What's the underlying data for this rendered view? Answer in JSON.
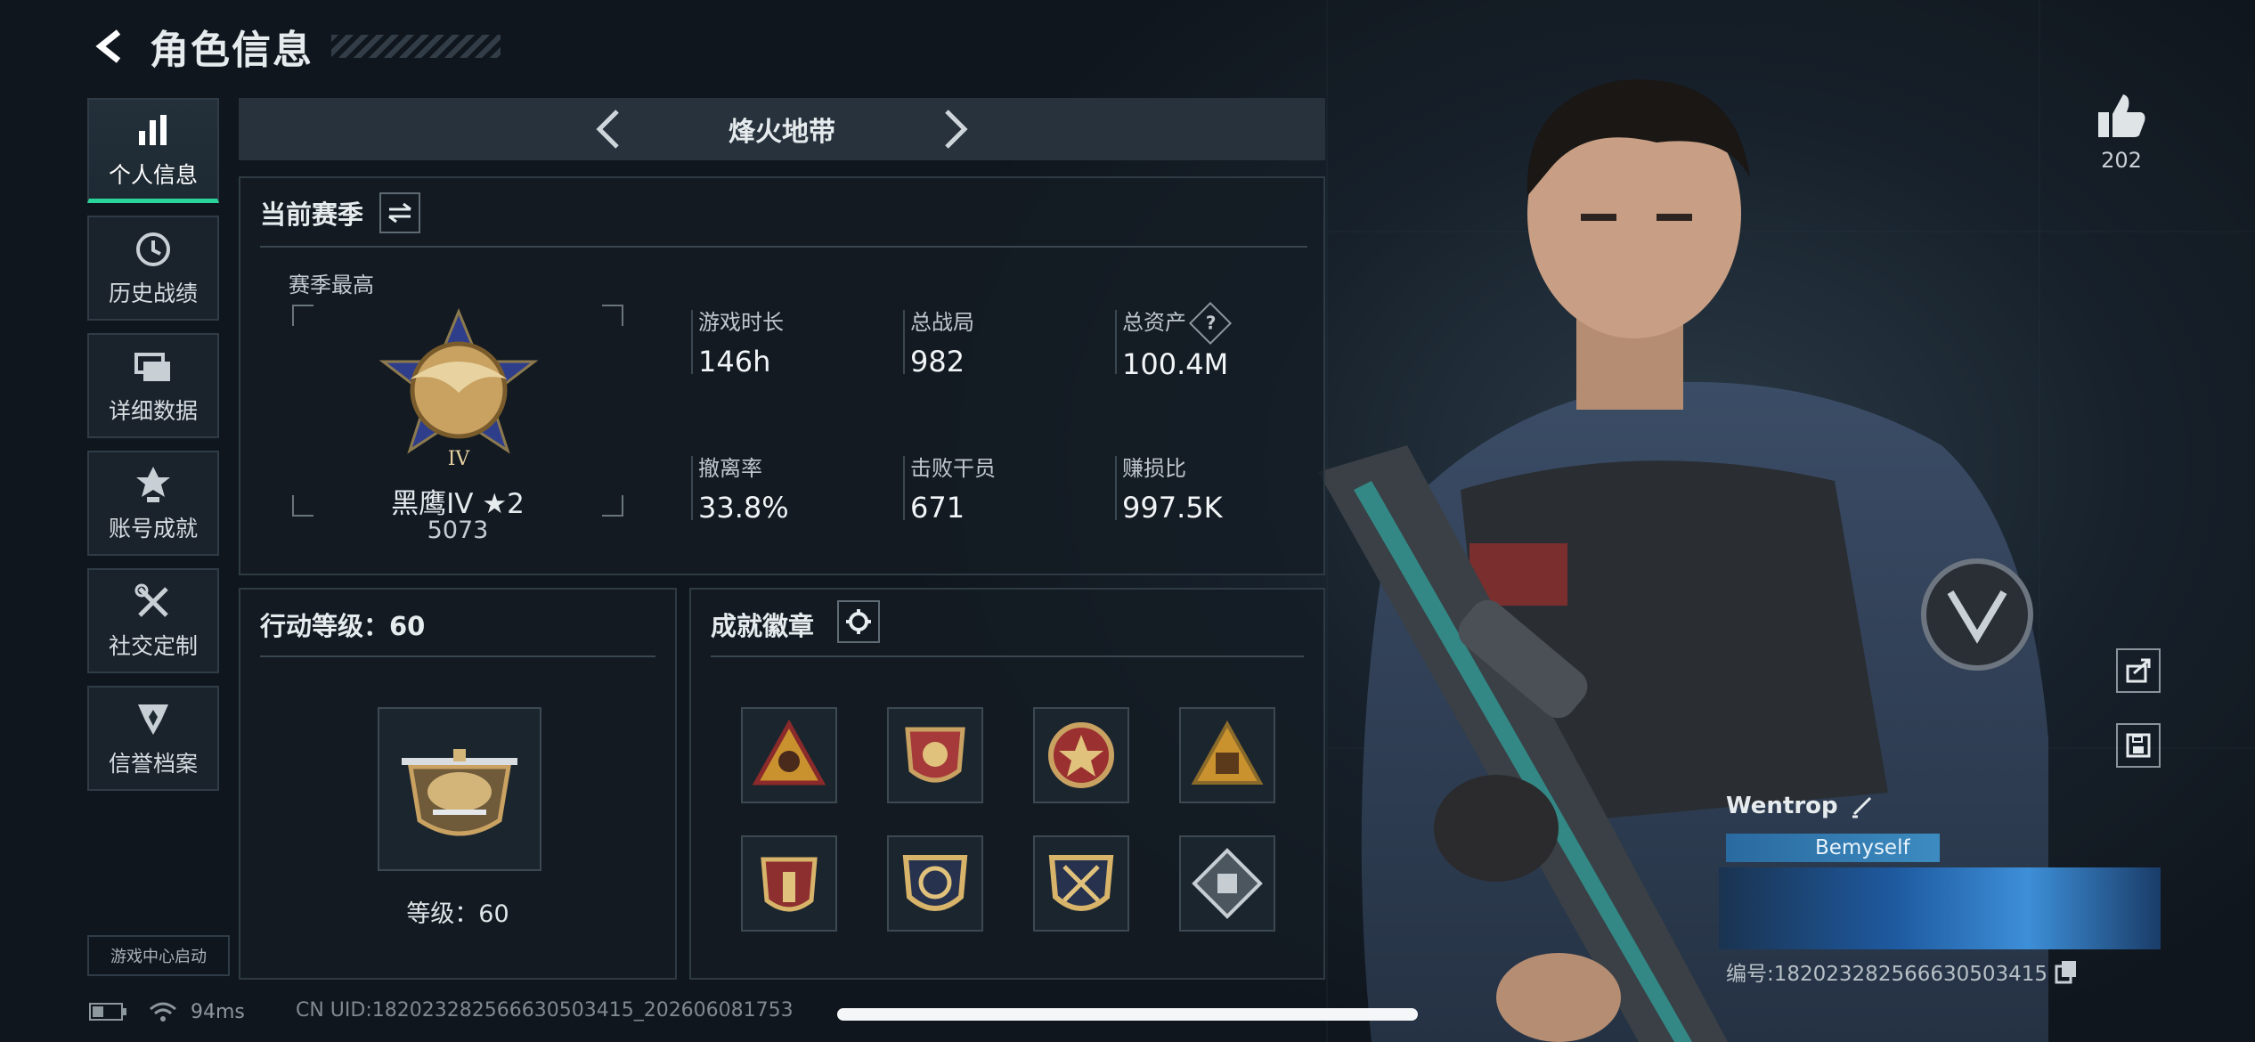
{
  "header": {
    "title": "角色信息"
  },
  "sidebar": {
    "items": [
      {
        "label": "个人信息",
        "icon": "bar-chart-icon",
        "active": true
      },
      {
        "label": "历史战绩",
        "icon": "clock-icon"
      },
      {
        "label": "详细数据",
        "icon": "folder-icon"
      },
      {
        "label": "账号成就",
        "icon": "medal-icon"
      },
      {
        "label": "社交定制",
        "icon": "tools-icon"
      },
      {
        "label": "信誉档案",
        "icon": "shield-icon"
      }
    ],
    "launch_label": "游戏中心启动"
  },
  "mode": {
    "title": "烽火地带"
  },
  "season": {
    "label": "当前赛季",
    "best_label": "赛季最高",
    "rank_name": "黑鹰IV ★2",
    "rank_score": "5073",
    "stats": [
      {
        "key": "游戏时长",
        "value": "146h"
      },
      {
        "key": "总战局",
        "value": "982"
      },
      {
        "key": "总资产",
        "value": "100.4M",
        "help": "?"
      },
      {
        "key": "撤离率",
        "value": "33.8%"
      },
      {
        "key": "击败干员",
        "value": "671"
      },
      {
        "key": "赚损比",
        "value": "997.5K"
      }
    ]
  },
  "level": {
    "title": "行动等级：60",
    "level_text": "等级：60"
  },
  "badges": {
    "title": "成就徽章",
    "items": [
      "badge-1",
      "badge-2",
      "badge-3",
      "badge-4",
      "badge-5",
      "badge-6",
      "badge-7",
      "badge-8"
    ]
  },
  "status": {
    "ping": "94ms",
    "uid": "CN UID:182023282566630503415_202606081753"
  },
  "profile": {
    "likes": "202",
    "name": "Wentrop",
    "tag": "Bemyself",
    "id_text": "编号:182023282566630503415"
  },
  "colors": {
    "accent": "#29d49a",
    "background": "#141c24",
    "panel_border": "#2e3a44"
  }
}
